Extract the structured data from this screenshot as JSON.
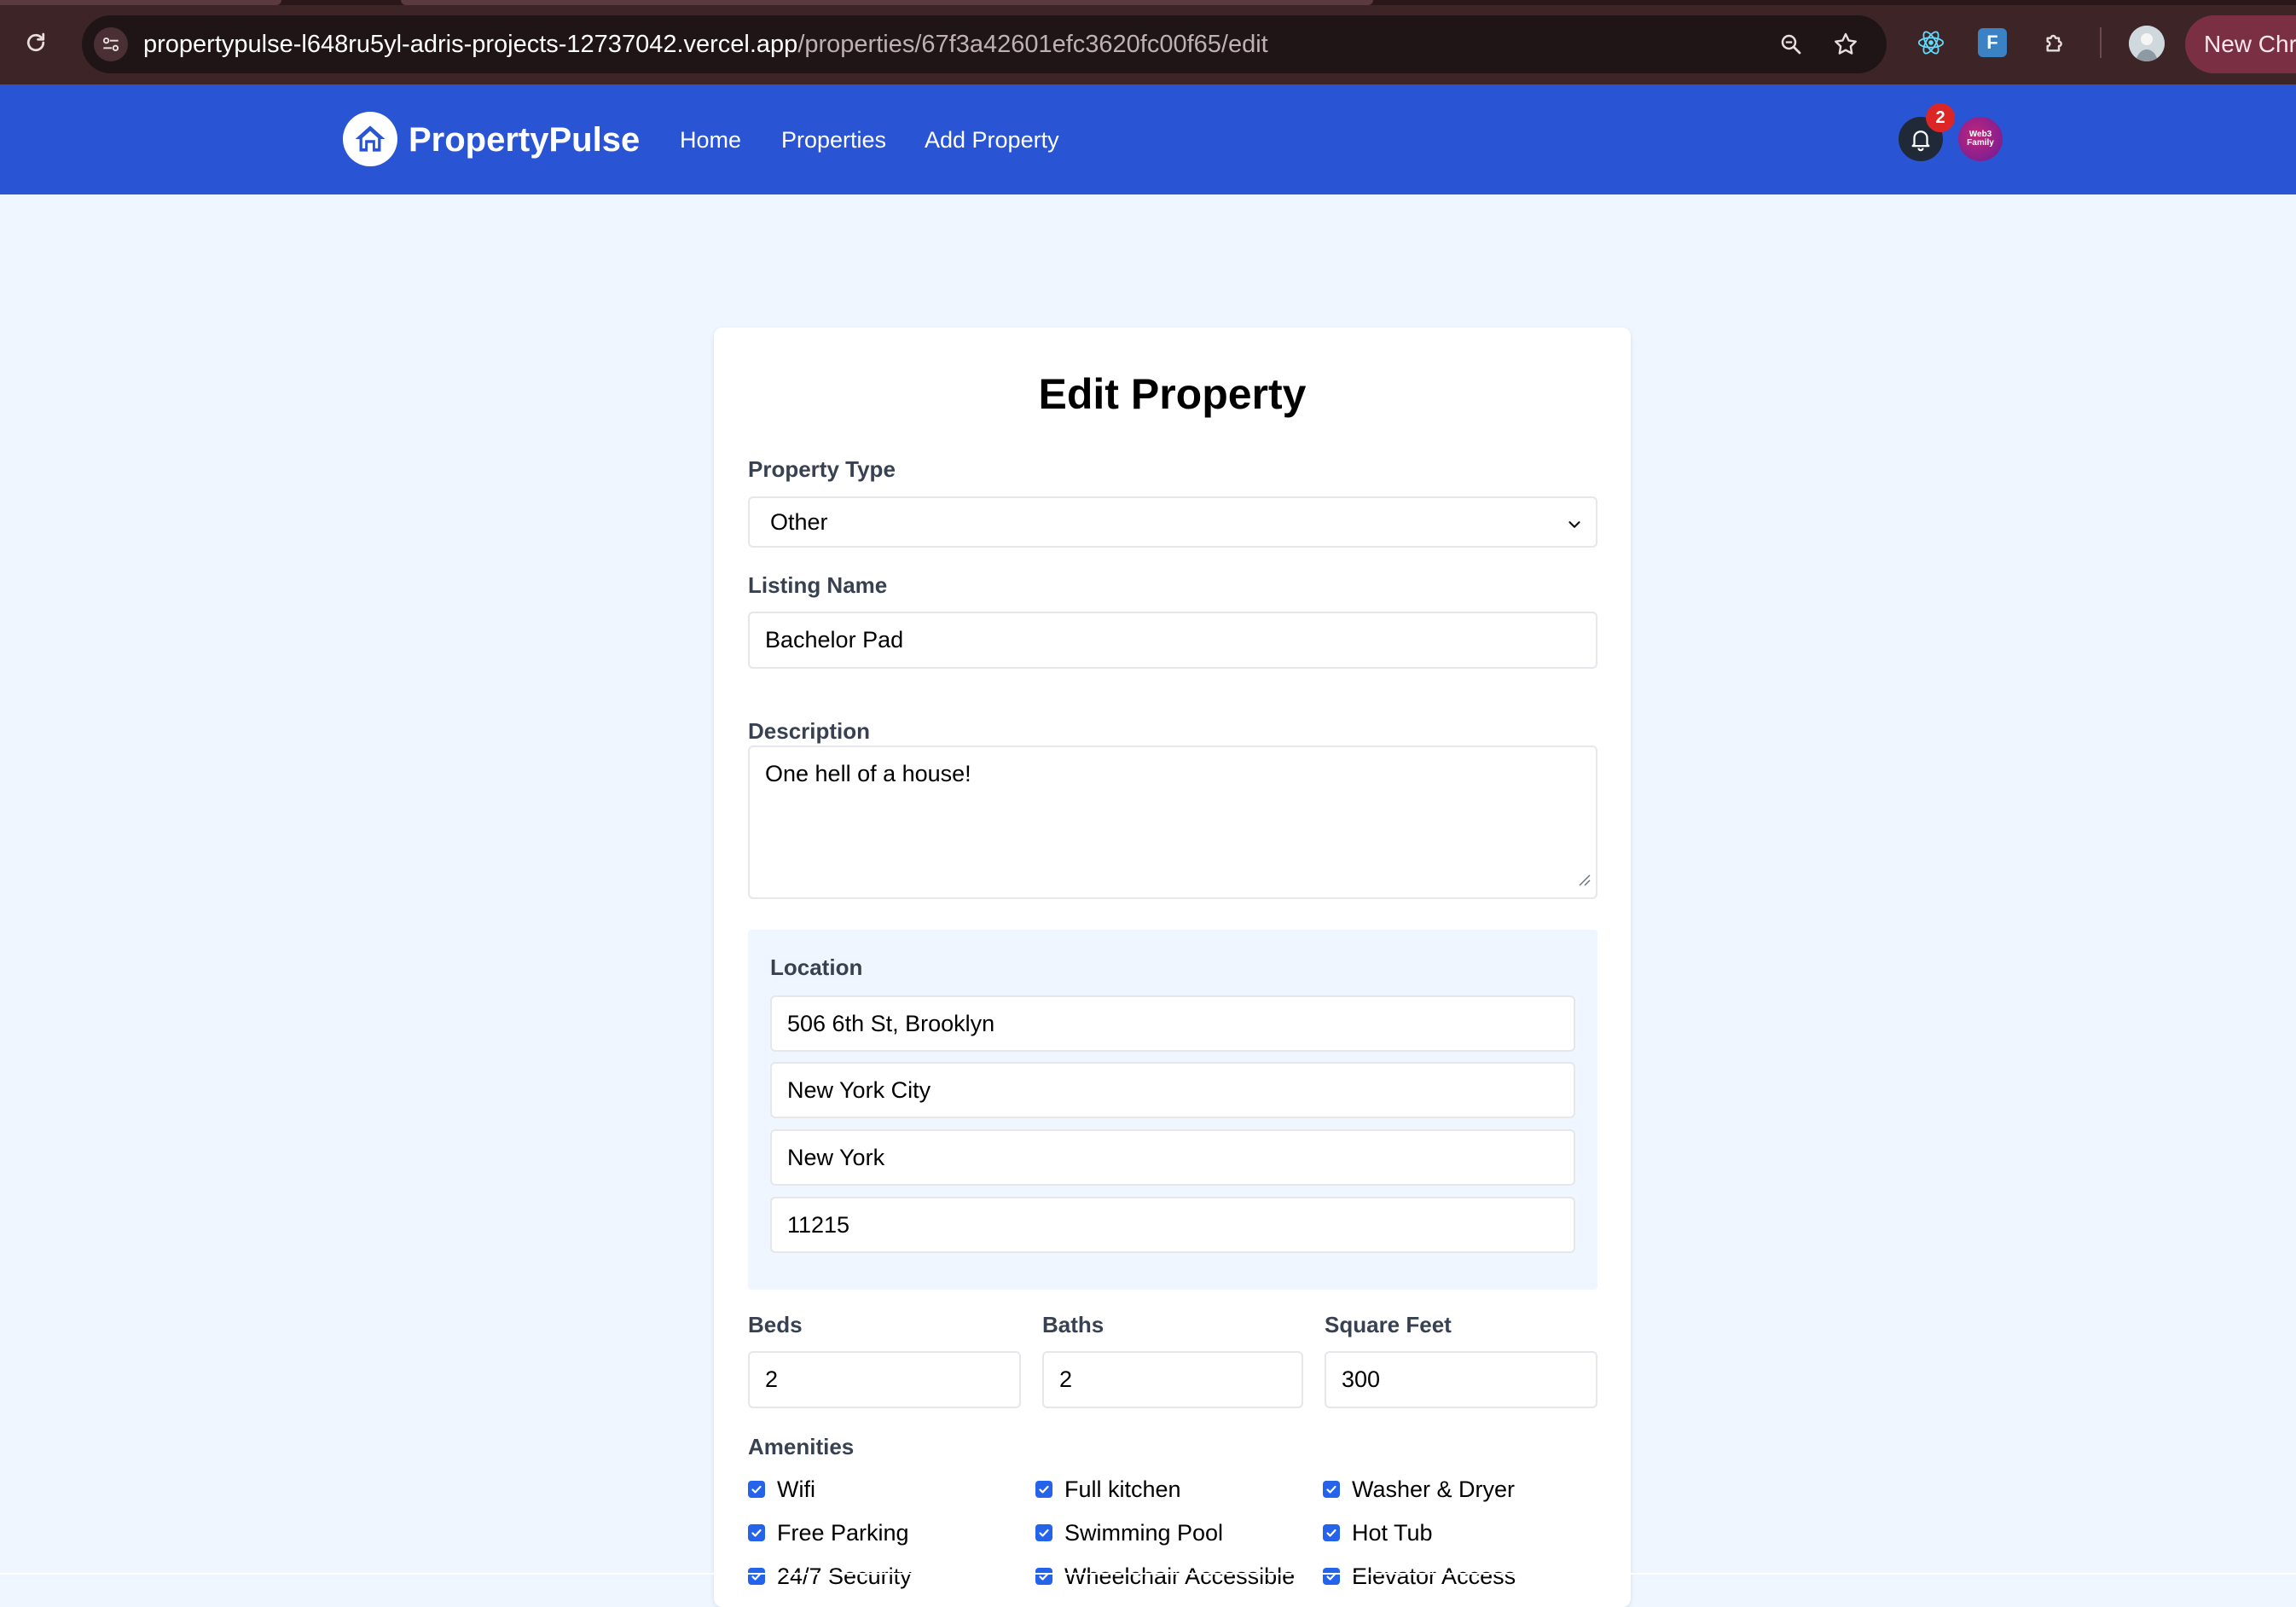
{
  "browser": {
    "url_host": "propertypulse-l648ru5yl-adris-projects-12737042.vercel.app",
    "url_path": "/properties/67f3a42601efc3620fc00f65/edit",
    "new_chrome_label": "New Chro"
  },
  "nav": {
    "brand": "PropertyPulse",
    "links": [
      "Home",
      "Properties",
      "Add Property"
    ],
    "notification_count": "2",
    "avatar_text": "Web3 Family"
  },
  "form": {
    "title": "Edit Property",
    "property_type": {
      "label": "Property Type",
      "value": "Other"
    },
    "listing_name": {
      "label": "Listing Name",
      "value": "Bachelor Pad"
    },
    "description": {
      "label": "Description",
      "value": "One hell of a house!"
    },
    "location": {
      "label": "Location",
      "street": "506 6th St, Brooklyn",
      "city": "New York City",
      "state": "New York",
      "zipcode": "11215"
    },
    "beds": {
      "label": "Beds",
      "value": "2"
    },
    "baths": {
      "label": "Baths",
      "value": "2"
    },
    "square_feet": {
      "label": "Square Feet",
      "value": "300"
    },
    "amenities": {
      "label": "Amenities",
      "items": [
        {
          "label": "Wifi",
          "checked": true
        },
        {
          "label": "Full kitchen",
          "checked": true
        },
        {
          "label": "Washer & Dryer",
          "checked": true
        },
        {
          "label": "Free Parking",
          "checked": true
        },
        {
          "label": "Swimming Pool",
          "checked": true
        },
        {
          "label": "Hot Tub",
          "checked": true
        },
        {
          "label": "24/7 Security",
          "checked": true
        },
        {
          "label": "Wheelchair Accessible",
          "checked": true
        },
        {
          "label": "Elevator Access",
          "checked": true
        }
      ]
    }
  },
  "colors": {
    "nav_bg": "#2954d4",
    "page_bg": "#eff6ff",
    "checkbox": "#2563eb",
    "badge": "#dc2626"
  }
}
